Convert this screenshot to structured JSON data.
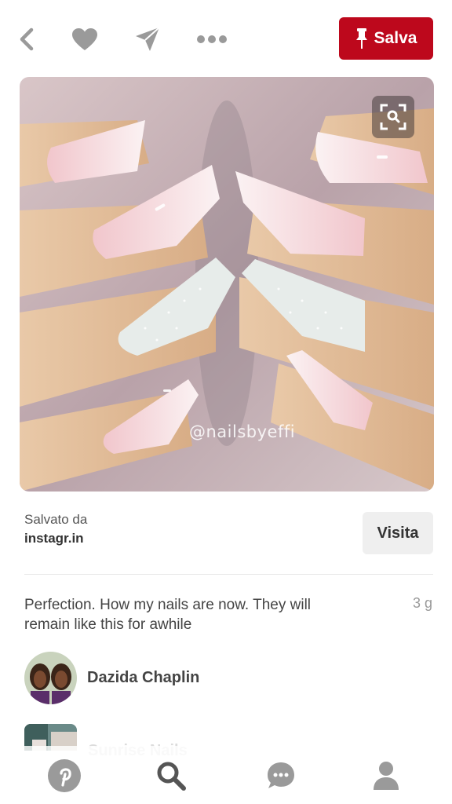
{
  "topbar": {
    "back_icon": "chevron-left-icon",
    "like_icon": "heart-icon",
    "send_icon": "paper-plane-icon",
    "more_icon": "ellipsis-icon",
    "save_label": "Salva"
  },
  "pin": {
    "watermark": "@nailsbyeffi",
    "visual_search_icon": "visual-search-icon"
  },
  "source": {
    "label": "Salvato da",
    "site": "instagr.in",
    "visit_label": "Visita"
  },
  "description": {
    "text": "Perfection. How my nails are now. They will remain like this for awhile",
    "time": "3 g"
  },
  "user": {
    "name": "Dazida Chaplin"
  },
  "board": {
    "name": "Sunrise Nails"
  },
  "nav": {
    "items": [
      "pinterest-home-icon",
      "search-icon",
      "chat-icon",
      "profile-icon"
    ]
  },
  "colors": {
    "accent": "#bd081c",
    "icon_gray": "#9a9a9a"
  }
}
